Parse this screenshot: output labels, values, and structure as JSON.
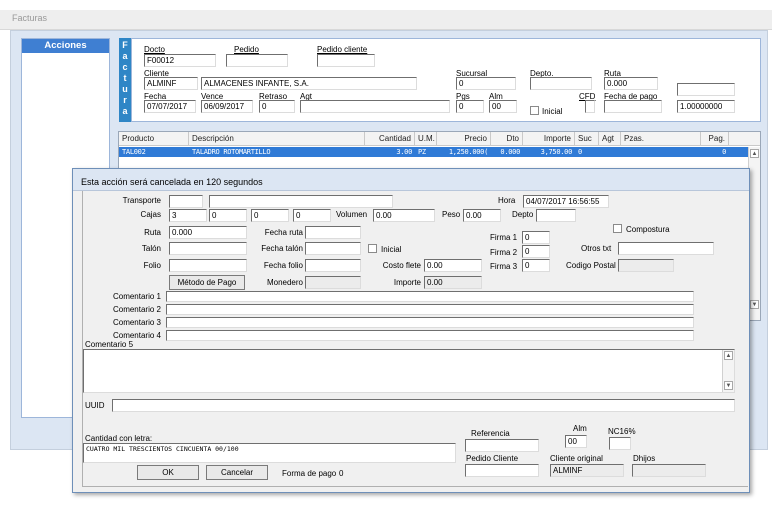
{
  "window": {
    "title": "Facturas"
  },
  "actions_panel": {
    "title": "Acciones"
  },
  "factura_band": {
    "letters": [
      "F",
      "a",
      "c",
      "t",
      "u",
      "r",
      "a"
    ]
  },
  "header": {
    "docto_label": "Docto",
    "docto_value": "F00012",
    "pedido_label": "Pedido",
    "pedido_value": "",
    "pedido_cliente_label": "Pedido cliente",
    "pedido_cliente_value": "",
    "cliente_label": "Cliente",
    "cliente_code": "ALMINF",
    "cliente_name": "ALMACENES INFANTE, S.A.",
    "sucursal_label": "Sucursal",
    "sucursal_value": "0",
    "depto_label": "Depto.",
    "depto_value": "",
    "ruta_label": "Ruta",
    "ruta_value": "0.000",
    "fecha_label": "Fecha",
    "fecha_value": "07/07/2017",
    "vence_label": "Vence",
    "vence_value": "06/09/2017",
    "retraso_label": "Retraso",
    "retraso_value": "0",
    "agt_label": "Agt",
    "agt_value": "",
    "pgs_label": "Pgs",
    "pgs_value": "0",
    "alm_label": "Alm",
    "alm_value": "00",
    "inicial_label": "Inicial",
    "cfd_label": "CFD",
    "fecha_pago_label": "Fecha de pago",
    "fecha_pago_value": "",
    "tipo_cambio_value": "1.00000000"
  },
  "grid": {
    "columns": [
      "Producto",
      "Descripción",
      "Cantidad",
      "U.M.",
      "Precio",
      "Dto",
      "Importe",
      "Suc",
      "Agt",
      "Pzas.",
      "Pag."
    ],
    "rows": [
      {
        "producto": "TAL002",
        "descripcion": "TALADRO ROTOMARTILLO",
        "cantidad": "3.00",
        "um": "PZ",
        "precio": "1,250.000(",
        "dto": "0.000",
        "importe": "3,750.00",
        "suc": "0",
        "agt": "",
        "pzas": "",
        "pag": "0"
      }
    ]
  },
  "dialog": {
    "title": "Esta acción será cancelada en  120 segundos",
    "transporte_label": "Transporte",
    "transporte_value": "",
    "transporte_desc": "",
    "hora_label": "Hora",
    "hora_value": "04/07/2017 16:56:55",
    "cajas_label": "Cajas",
    "cajas_values": [
      "3",
      "0",
      "0",
      "0"
    ],
    "volumen_label": "Volumen",
    "volumen_value": "0.00",
    "peso_label": "Peso",
    "peso_value": "0.00",
    "depto_label": "Depto",
    "depto_value": "",
    "ruta_label": "Ruta",
    "ruta_value": "0.000",
    "fecha_ruta_label": "Fecha ruta",
    "fecha_ruta_value": "",
    "firma1_label": "Firma 1",
    "firma1_value": "0",
    "compostura_label": "Compostura",
    "talon_label": "Talón",
    "talon_value": "",
    "fecha_talon_label": "Fecha talón",
    "fecha_talon_value": "",
    "inicial_label": "Inicial",
    "firma2_label": "Firma 2",
    "firma2_value": "0",
    "otros_txt_label": "Otros txt",
    "otros_txt_value": "",
    "folio_label": "Folio",
    "folio_value": "",
    "fecha_folio_label": "Fecha folio",
    "fecha_folio_value": "",
    "costo_flete_label": "Costo flete",
    "costo_flete_value": "0.00",
    "firma3_label": "Firma 3",
    "firma3_value": "0",
    "codigo_postal_label": "Codigo Postal",
    "codigo_postal_value": "",
    "metodo_pago_label": "Método de Pago",
    "monedero_label": "Monedero",
    "monedero_value": "",
    "importe_label": "Importe",
    "importe_value": "0.00",
    "comentario1_label": "Comentario 1",
    "comentario2_label": "Comentario 2",
    "comentario3_label": "Comentario 3",
    "comentario4_label": "Comentario 4",
    "comentario5_label": "Comentario 5",
    "uuid_label": "UUID",
    "uuid_value": "",
    "cantidad_letra_label": "Cantidad con letra:",
    "cantidad_letra_value": "CUATRO MIL TRESCIENTOS CINCUENTA 00/100",
    "referencia_label": "Referencia",
    "referencia_value": "",
    "alm_label": "Alm",
    "alm_value": "00",
    "nc16_label": "NC16%",
    "nc16_value": "",
    "pedido_cliente_label": "Pedido Cliente",
    "pedido_cliente_value": "",
    "cliente_original_label": "Cliente original",
    "cliente_original_value": "ALMINF",
    "dhijos_label": "Dhijos",
    "dhijos_value": "",
    "ok_label": "OK",
    "cancelar_label": "Cancelar",
    "forma_pago_label": "Forma de pago",
    "forma_pago_value": "0"
  }
}
